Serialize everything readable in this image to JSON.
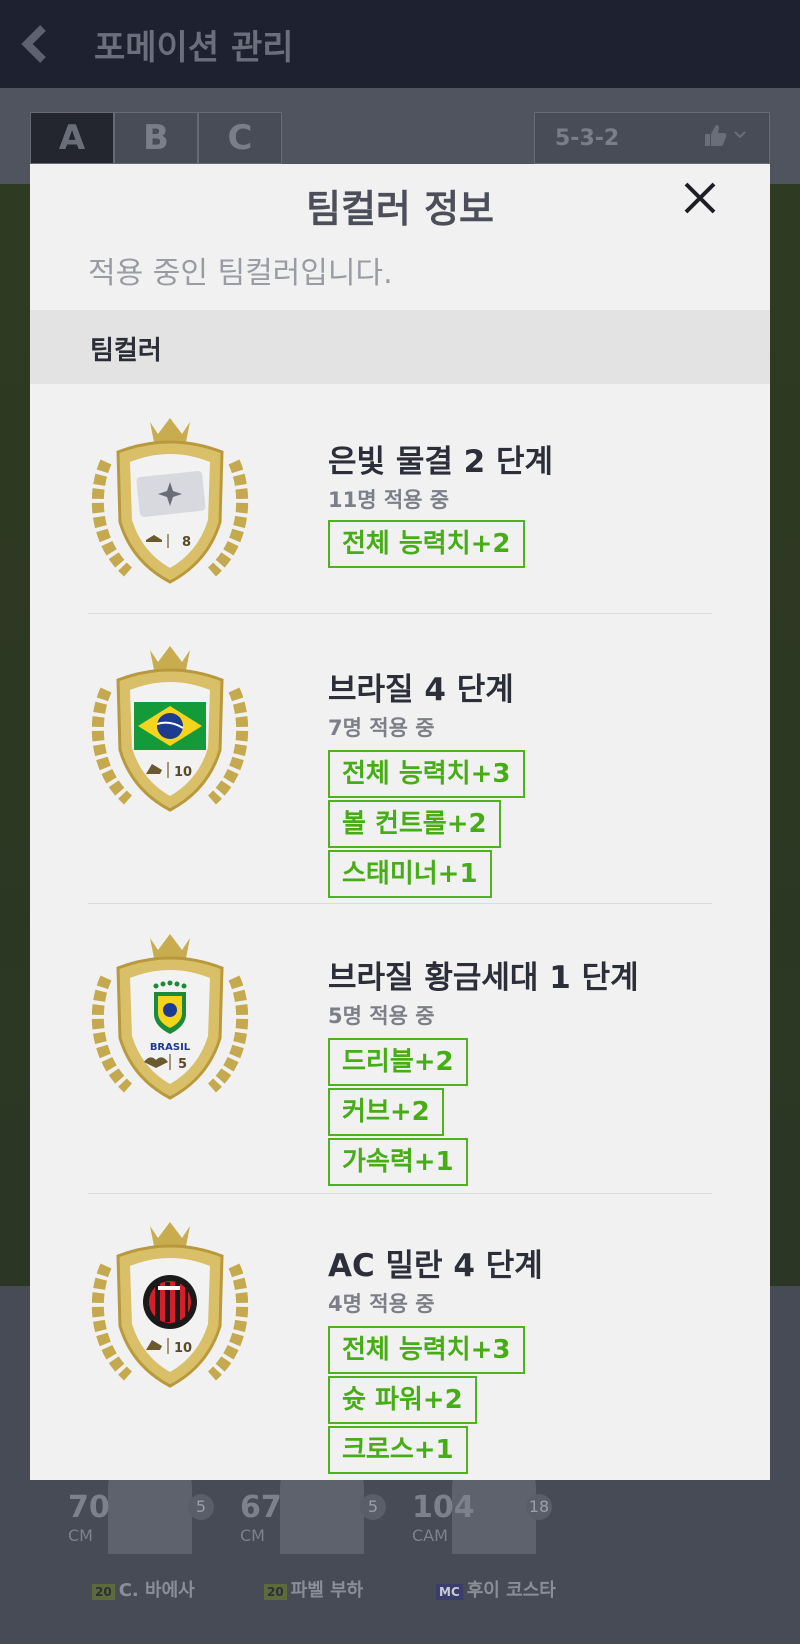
{
  "app": {
    "title": "포메이션 관리"
  },
  "tabs": [
    "A",
    "B",
    "C"
  ],
  "formation": "5-3-2",
  "players": [
    {
      "ovr": "70",
      "pos": "CM",
      "level": "5",
      "season": "20",
      "name": "C. 바에사"
    },
    {
      "ovr": "67",
      "pos": "CM",
      "level": "5",
      "season": "20",
      "name": "파벨 부하"
    },
    {
      "ovr": "104",
      "pos": "CAM",
      "level": "18",
      "season": "MC",
      "name": "후이 코스타"
    }
  ],
  "modal": {
    "title": "팀컬러 정보",
    "subtitle": "적용 중인 팀컬러입니다.",
    "section_label": "팀컬러",
    "entries": [
      {
        "name": "은빛 물결 2 단계",
        "count": "11명 적용 중",
        "crest_number": "8",
        "bonuses": [
          "전체 능력치+2"
        ]
      },
      {
        "name": "브라질 4 단계",
        "count": "7명 적용 중",
        "crest_number": "10",
        "bonuses": [
          "전체 능력치+3",
          "볼 컨트롤+2",
          "스태미너+1"
        ]
      },
      {
        "name": "브라질 황금세대 1 단계",
        "count": "5명 적용 중",
        "crest_number": "5",
        "crest_text": "BRASIL",
        "bonuses": [
          "드리블+2",
          "커브+2",
          "가속력+1"
        ]
      },
      {
        "name": "AC 밀란 4 단계",
        "count": "4명 적용 중",
        "crest_number": "10",
        "bonuses": [
          "전체 능력치+3",
          "슛 파워+2",
          "크로스+1"
        ]
      }
    ]
  },
  "colors": {
    "accent_green": "#4eb31c",
    "modal_bg": "#f1f1f1",
    "header_bg": "#1e2230"
  }
}
